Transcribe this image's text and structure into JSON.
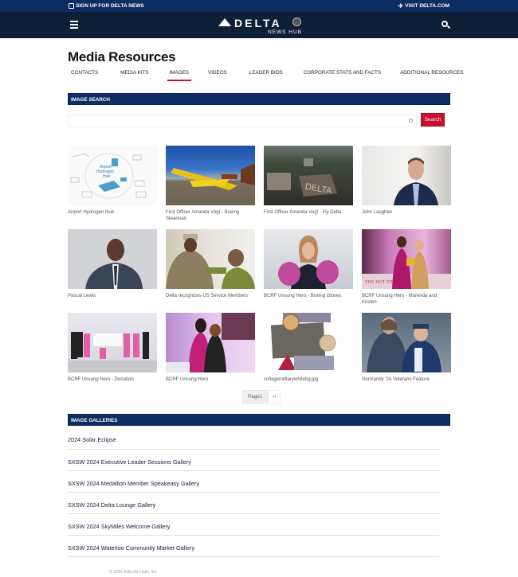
{
  "topbar": {
    "signup_label": "SIGN UP FOR DELTA NEWS",
    "signup_icon": "newsletter-icon",
    "visit_label": "VISIT DELTA.COM",
    "visit_icon": "plane-icon"
  },
  "header": {
    "logo_word": "DELTA",
    "logo_sub": "NEWS HUB",
    "menu_icon": "hamburger-icon",
    "search_icon": "search-icon"
  },
  "page": {
    "title": "Media Resources"
  },
  "tabs": [
    {
      "label": "CONTACTS",
      "active": false
    },
    {
      "label": "MEDIA KITS",
      "active": false
    },
    {
      "label": "IMAGES",
      "active": true
    },
    {
      "label": "VIDEOS",
      "active": false
    },
    {
      "label": "LEADER BIOS",
      "active": false
    },
    {
      "label": "CORPORATE STATS AND FACTS",
      "active": false
    },
    {
      "label": "ADDITIONAL RESOURCES",
      "active": false
    }
  ],
  "image_search": {
    "heading": "IMAGE SEARCH",
    "input_value": "",
    "input_placeholder": "",
    "button_label": "Search"
  },
  "images": [
    {
      "caption": "Airport Hydrogen Hub"
    },
    {
      "caption": "First Officer Amanda Vogt - Boeing Stearman"
    },
    {
      "caption": "First Officer Amanda Vogt - Fly Delta"
    },
    {
      "caption": "John Laughter"
    },
    {
      "caption": "Pascal Lewis"
    },
    {
      "caption": "Delta recognizes US Service Members"
    },
    {
      "caption": "BCRF Unsung Hero - Boxing Gloves"
    },
    {
      "caption": "BCRF Unsung Hero - Marenda and Kristen"
    },
    {
      "caption": "BCRF Unsung Hero - Donation"
    },
    {
      "caption": "BCRF Unsung Hero"
    },
    {
      "caption": "collagemilitarywhitebg.jpg"
    },
    {
      "caption": "Normandy '24 Veterans Feature"
    }
  ],
  "pagination": {
    "current": "Page1",
    "next": "››"
  },
  "galleries": {
    "heading": "IMAGE GALLERIES",
    "items": [
      "2024 Solar Eclipse",
      "SXSW 2024 Executive Leader Sessions Gallery",
      "SXSW 2024 Medallion Member Speakeasy Gallery",
      "SXSW 2024 Delta Lounge Gallery",
      "SXSW 2024 SkyMiles Welcome Gallery",
      "SXSW 2024 Waterloo Community Market Gallery"
    ]
  },
  "footer": {
    "copyright": "© 2024 Delta Air Lines, Inc."
  },
  "colors": {
    "navy": "#0b2d62",
    "header_dark": "#0e1f38",
    "accent_red": "#c8102e"
  }
}
